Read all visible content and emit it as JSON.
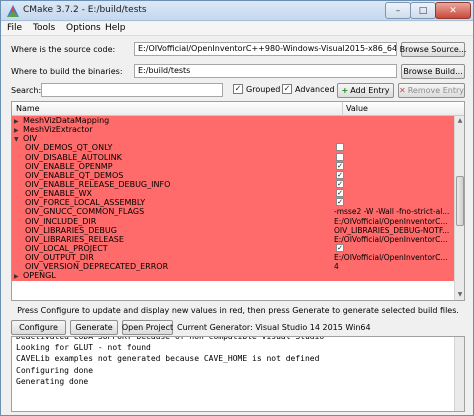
{
  "window": {
    "title": "CMake 3.7.2 - E:/build/tests",
    "minimize_glyph": "–",
    "maximize_glyph": "□",
    "close_glyph": "✕"
  },
  "menu": [
    "File",
    "Tools",
    "Options",
    "Help"
  ],
  "source": {
    "label": "Where is the source code:",
    "value": "E:/OIVofficial/OpenInventorC++980-Windows-Visual2015-x86_64/examples",
    "button": "Browse Source..."
  },
  "build": {
    "label": "Where to build the binaries:",
    "value": "E:/build/tests",
    "button": "Browse Build..."
  },
  "search": {
    "label": "Search:",
    "value": "",
    "grouped_label": "Grouped",
    "grouped_checked": true,
    "advanced_label": "Advanced",
    "advanced_checked": true,
    "add_entry": "Add Entry",
    "remove_entry": "Remove Entry"
  },
  "table": {
    "col_name": "Name",
    "col_value": "Value",
    "rows": [
      {
        "name": "MeshVizDataMapping",
        "level": 0,
        "expand": "▶",
        "value": ""
      },
      {
        "name": "MeshVizExtractor",
        "level": 0,
        "expand": "▶",
        "value": ""
      },
      {
        "name": "OIV",
        "level": 0,
        "expand": "▼",
        "value": ""
      },
      {
        "name": "OIV_DEMOS_QT_ONLY",
        "level": 1,
        "check": ""
      },
      {
        "name": "OIV_DISABLE_AUTOLINK",
        "level": 1,
        "check": ""
      },
      {
        "name": "OIV_ENABLE_OPENMP",
        "level": 1,
        "check": "✓"
      },
      {
        "name": "OIV_ENABLE_QT_DEMOS",
        "level": 1,
        "check": "✓"
      },
      {
        "name": "OIV_ENABLE_RELEASE_DEBUG_INFO",
        "level": 1,
        "check": "✓"
      },
      {
        "name": "OIV_ENABLE_WX",
        "level": 1,
        "check": "✓"
      },
      {
        "name": "OIV_FORCE_LOCAL_ASSEMBLY",
        "level": 1,
        "check": "✓"
      },
      {
        "name": "OIV_GNUCC_COMMON_FLAGS",
        "level": 1,
        "value": "-msse2 -W -Wall -fno-strict-al..."
      },
      {
        "name": "OIV_INCLUDE_DIR",
        "level": 1,
        "value": "E:/OIVofficial/OpenInventorC..."
      },
      {
        "name": "OIV_LIBRARIES_DEBUG",
        "level": 1,
        "value": "OIV_LIBRARIES_DEBUG-NOTF..."
      },
      {
        "name": "OIV_LIBRARIES_RELEASE",
        "level": 1,
        "value": "E:/OIVofficial/OpenInventorC..."
      },
      {
        "name": "OIV_LOCAL_PROJECT",
        "level": 1,
        "check": "✓"
      },
      {
        "name": "OIV_OUTPUT_DIR",
        "level": 1,
        "value": "E:/OIVofficial/OpenInventorC..."
      },
      {
        "name": "OIV_VERSION_DEPRECATED_ERROR",
        "level": 1,
        "value": "4"
      },
      {
        "name": "OPENGL",
        "level": 0,
        "expand": "▶",
        "value": ""
      }
    ]
  },
  "info_text": "Press Configure to update and display new values in red, then press Generate to generate selected build files.",
  "buttons": {
    "configure": "Configure",
    "generate": "Generate",
    "open_project": "Open Project"
  },
  "generator_text": "Current Generator: Visual Studio 14 2015 Win64",
  "output_lines": [
    "Deactivated CUDA SUPPORT because of non compatible Visual Studio",
    "Looking for GLUT - not found",
    "CAVELib examples not generated because CAVE_HOME is not defined",
    "Configuring done",
    "Generating done"
  ],
  "colors": {
    "new_row": "#ff6b6b"
  }
}
